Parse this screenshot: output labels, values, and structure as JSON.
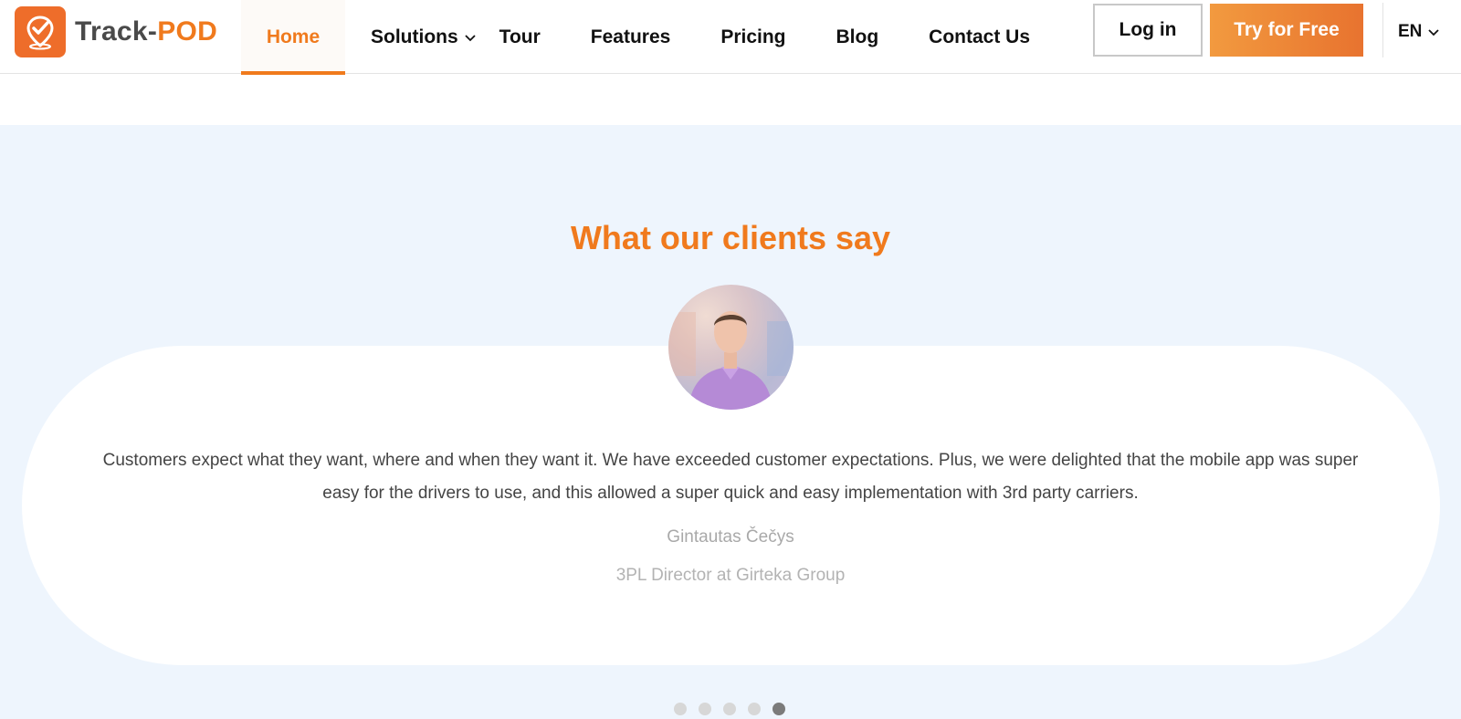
{
  "brand": {
    "name_part1": "Track-",
    "name_part2": "POD",
    "accent_color": "#f07a1d",
    "logo_icon": "map-pin-check-icon"
  },
  "nav": {
    "items": [
      {
        "label": "Home",
        "active": true
      },
      {
        "label": "Solutions",
        "has_dropdown": true
      },
      {
        "label": "Tour"
      },
      {
        "label": "Features"
      },
      {
        "label": "Pricing"
      },
      {
        "label": "Blog"
      },
      {
        "label": "Contact Us"
      }
    ]
  },
  "header_actions": {
    "login_label": "Log in",
    "try_label": "Try for Free",
    "language": "EN"
  },
  "testimonials": {
    "title": "What our clients say",
    "quote": "Customers expect what they want, where and when they want it. We have exceeded customer expectations. Plus, we were delighted that the mobile app was super easy for the drivers to use, and this allowed a super quick and easy implementation with 3rd party carriers.",
    "author": "Gintautas Čečys",
    "role": "3PL Director at Girteka Group",
    "slide_count": 5,
    "active_slide": 5
  },
  "colors": {
    "section_bg": "#eef5fd",
    "button_gradient_start": "#f29a3f",
    "button_gradient_end": "#e8732f"
  }
}
